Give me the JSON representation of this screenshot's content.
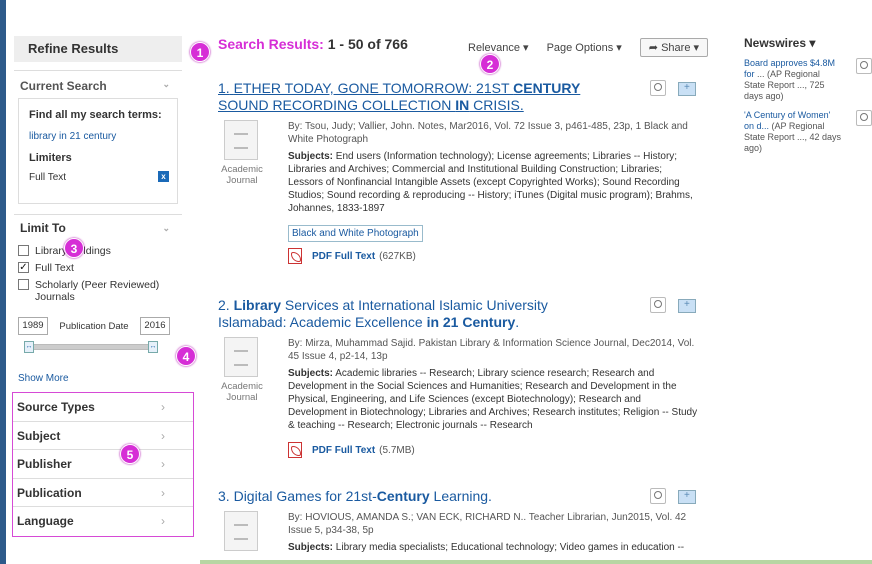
{
  "sidebar": {
    "refine_title": "Refine Results",
    "current_search": {
      "heading": "Current Search",
      "find_all": "Find all my search terms:",
      "term": "library in 21 century",
      "limiters_heading": "Limiters",
      "limiter": "Full Text",
      "remove": "x"
    },
    "limit_to": {
      "heading": "Limit To",
      "options": [
        {
          "label": "Library Holdings",
          "checked": false
        },
        {
          "label": "Full Text",
          "checked": true
        },
        {
          "label": "Scholarly (Peer Reviewed) Journals",
          "checked": false
        }
      ],
      "date_from": "1989",
      "date_label": "Publication Date",
      "date_to": "2016",
      "show_more": "Show More"
    },
    "facets": [
      "Source Types",
      "Subject",
      "Publisher",
      "Publication",
      "Language"
    ]
  },
  "main": {
    "results_label": "Search Results:",
    "results_range": "1 - 50 of 766",
    "toolbar": {
      "relevance": "Relevance ▾",
      "page_options": "Page Options ▾",
      "share": "Share ▾"
    }
  },
  "results": [
    {
      "number": "1.",
      "title_parts": [
        "ETHER TODAY, GONE TOMORROW: 21ST ",
        "CENTURY",
        " SOUND RECORDING COLLECTION ",
        "IN",
        " CRISIS."
      ],
      "type": "Academic Journal",
      "byline": "By: Tsou, Judy; Vallier, John. Notes, Mar2016, Vol. 72 Issue 3, p461-485, 23p, 1 Black and White Photograph",
      "subjects_label": "Subjects:",
      "subjects": "End users (Information technology); License agreements; Libraries -- History; Libraries and Archives; Commercial and Institutional Building Construction; Libraries; Lessors of Nonfinancial Intangible Assets (except Copyrighted Works); Sound Recording Studios; Sound recording & reproducing -- History; iTunes (Digital music program); Brahms, Johannes, 1833-1897",
      "tag": "Black and White Photograph",
      "pdf_label": "PDF Full Text",
      "pdf_size": "(627KB)"
    },
    {
      "number": "2.",
      "title_parts": [
        "Library",
        " Services at International Islamic University Islamabad: Academic Excellence ",
        "in 21 Century",
        "."
      ],
      "type": "Academic Journal",
      "byline": "By: Mirza, Muhammad Sajid. Pakistan Library & Information Science Journal, Dec2014, Vol. 45 Issue 4, p2-14, 13p",
      "subjects_label": "Subjects:",
      "subjects": "Academic libraries -- Research; Library science research; Research and Development in the Social Sciences and Humanities; Research and Development in the Physical, Engineering, and Life Sciences (except Biotechnology); Research and Development in Biotechnology; Libraries and Archives; Research institutes; Religion -- Study & teaching -- Research; Electronic journals -- Research",
      "pdf_label": "PDF Full Text",
      "pdf_size": "(5.7MB)"
    },
    {
      "number": "3.",
      "title_parts": [
        "Digital Games for 21st-",
        "Century",
        " Learning."
      ],
      "byline": "By: HOVIOUS, AMANDA S.; VAN ECK, RICHARD N.. Teacher Librarian, Jun2015, Vol. 42 Issue 5, p34-38, 5p",
      "subjects_label": "Subjects:",
      "subjects": "Library media specialists; Educational technology; Video games in education --"
    }
  ],
  "newswires": {
    "title": "Newswires ▾",
    "items": [
      {
        "link": "Board approves $4.8M for",
        "rest": "... (AP Regional State Report ..., 725 days ago)"
      },
      {
        "link": "'A Century of Women' on d...",
        "rest": "(AP Regional State Report ..., 42 days ago)"
      }
    ]
  },
  "badges": [
    "1",
    "2",
    "3",
    "4",
    "5"
  ]
}
